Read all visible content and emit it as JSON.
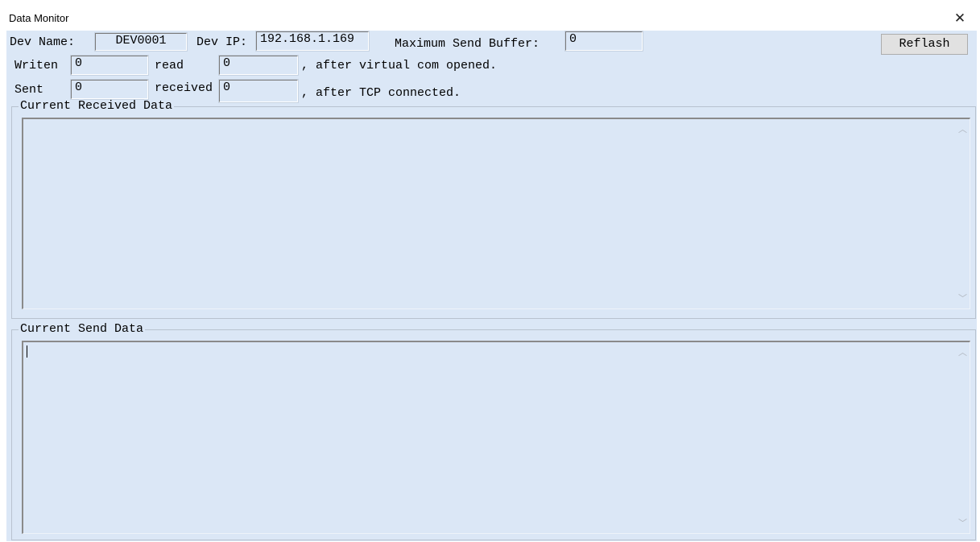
{
  "window": {
    "title": "Data Monitor"
  },
  "row1": {
    "dev_name_label": "Dev Name:",
    "dev_name_value": "DEV0001",
    "dev_ip_label": "Dev IP:",
    "dev_ip_value": "192.168.1.169",
    "max_buffer_label": "Maximum Send Buffer:",
    "max_buffer_value": "0",
    "refresh_label": "Reflash"
  },
  "row2": {
    "writen_label": "Writen",
    "writen_value": "0",
    "read_label": "read",
    "read_value": "0",
    "note": ", after virtual com opened."
  },
  "row3": {
    "sent_label": "Sent",
    "sent_value": "0",
    "received_label": "received",
    "received_value": "0",
    "note": ", after TCP connected."
  },
  "received_group": {
    "label": "Current Received Data",
    "content": ""
  },
  "send_group": {
    "label": "Current Send Data",
    "content": ""
  },
  "icons": {
    "close": "close-icon",
    "scroll_up": "chevron-up-icon",
    "scroll_down": "chevron-down-icon"
  }
}
